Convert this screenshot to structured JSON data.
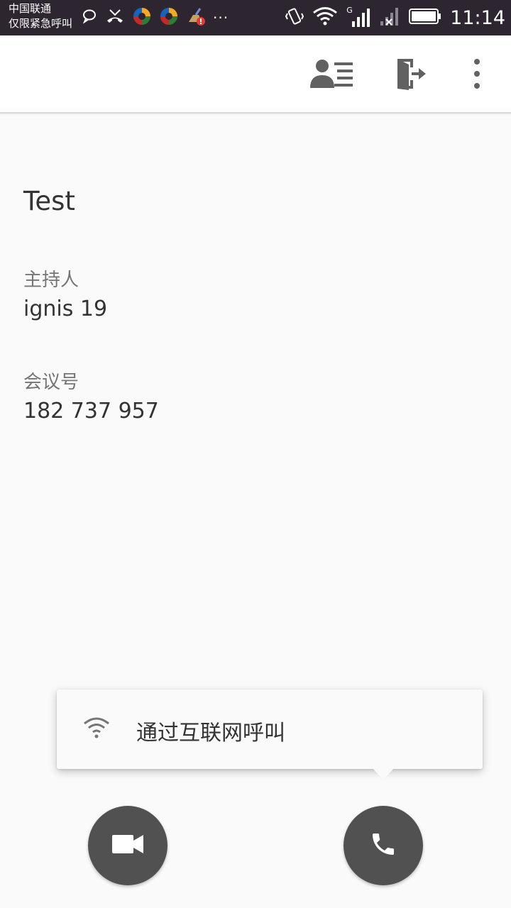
{
  "status_bar": {
    "carrier_line1": "中国联通",
    "carrier_line2": "仅限紧急呼叫",
    "network_type": "G",
    "time": "11:14",
    "more": "···"
  },
  "app_bar": {
    "icons": [
      "participants-icon",
      "exit-meeting-icon",
      "more-vert-icon"
    ]
  },
  "meeting": {
    "title": "Test",
    "host_label": "主持人",
    "host_value": "ignis 19",
    "number_label": "会议号",
    "number_value": "182 737 957"
  },
  "popup": {
    "text": "通过互联网呼叫"
  },
  "actions": {
    "video": "video-call-icon",
    "phone": "phone-call-icon"
  }
}
